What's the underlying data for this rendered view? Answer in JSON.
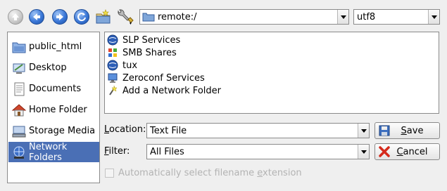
{
  "toolbar": {
    "buttons": [
      {
        "name": "up",
        "icon": "up-arrow-icon"
      },
      {
        "name": "back",
        "icon": "back-arrow-icon"
      },
      {
        "name": "forward",
        "icon": "forward-arrow-icon"
      },
      {
        "name": "reload",
        "icon": "reload-icon"
      },
      {
        "name": "new-folder",
        "icon": "new-folder-icon"
      },
      {
        "name": "options",
        "icon": "wrench-icon"
      }
    ],
    "location_path": "remote:/",
    "encoding": "utf8"
  },
  "sidebar": {
    "items": [
      {
        "label": "public_html",
        "icon": "folder-icon",
        "selected": false
      },
      {
        "label": "Desktop",
        "icon": "desktop-icon",
        "selected": false
      },
      {
        "label": "Documents",
        "icon": "documents-icon",
        "selected": false
      },
      {
        "label": "Home Folder",
        "icon": "home-icon",
        "selected": false
      },
      {
        "label": "Storage Media",
        "icon": "storage-icon",
        "selected": false
      },
      {
        "label": "Network Folders",
        "icon": "network-icon",
        "selected": true
      }
    ]
  },
  "files": [
    {
      "label": "SLP Services",
      "icon": "globe-icon"
    },
    {
      "label": "SMB Shares",
      "icon": "windows-icon"
    },
    {
      "label": "tux",
      "icon": "globe-icon"
    },
    {
      "label": "Zeroconf Services",
      "icon": "monitor-icon"
    },
    {
      "label": "Add a Network Folder",
      "icon": "wizard-icon"
    }
  ],
  "form": {
    "location_label_first": "L",
    "location_label_rest": "ocation:",
    "location_value": "Text File",
    "filter_label_first": "F",
    "filter_label_rest": "ilter:",
    "filter_value": "All Files",
    "auto_ext_pre": "Automatically select filename ",
    "auto_ext_mnemonic": "e",
    "auto_ext_post": "xtension",
    "auto_ext_checked": false
  },
  "buttons": {
    "save_first": "S",
    "save_rest": "ave",
    "cancel_first": "C",
    "cancel_rest": "ancel"
  },
  "colors": {
    "selection": "#4a6fb5",
    "window_bg": "#efefef"
  }
}
